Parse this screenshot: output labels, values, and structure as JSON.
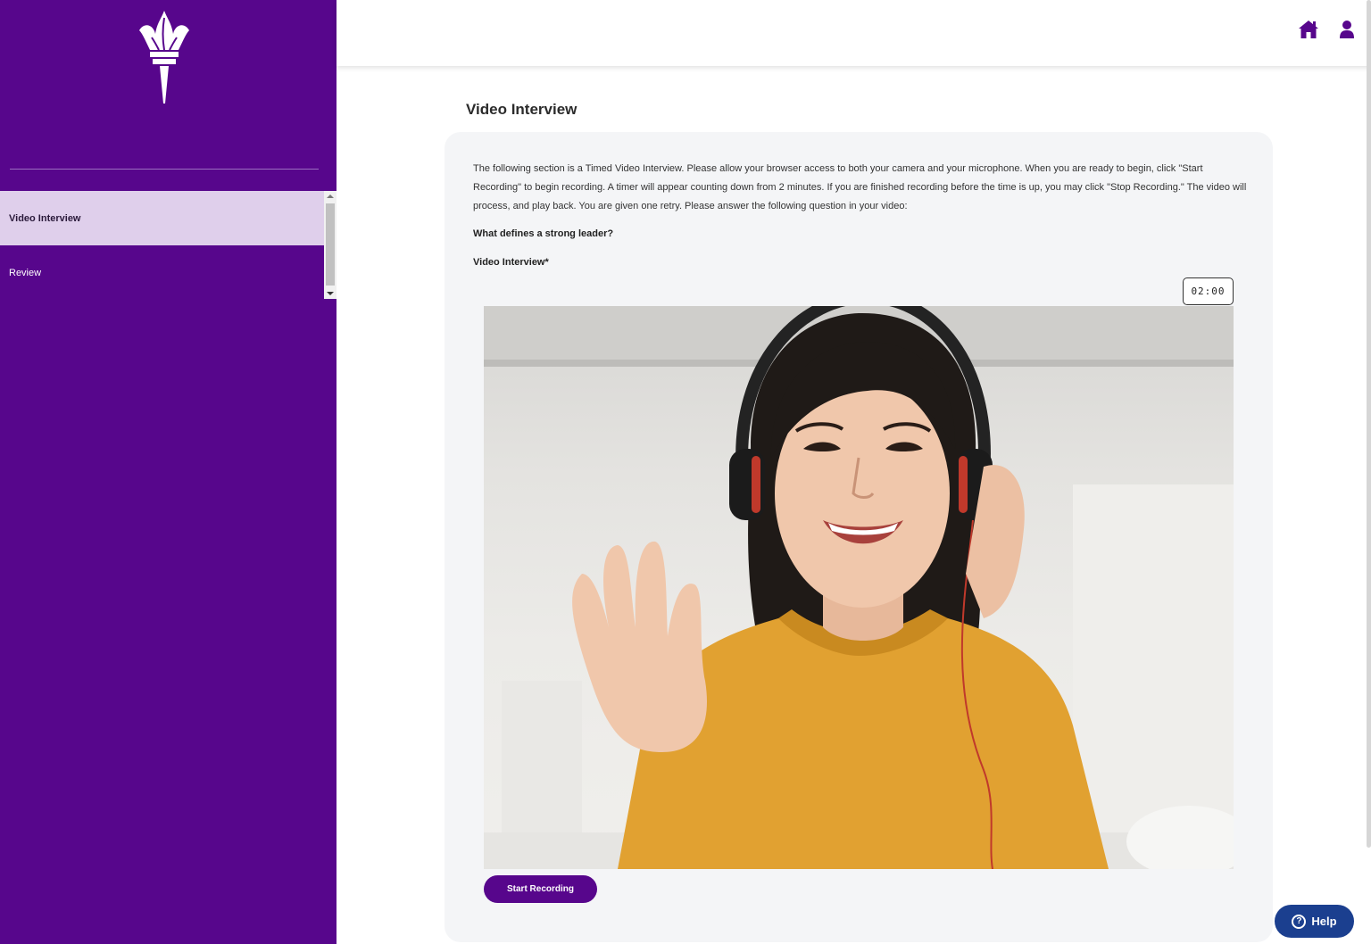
{
  "sidebar": {
    "items": [
      {
        "label": "Video Interview",
        "active": true
      },
      {
        "label": "Review",
        "active": false
      }
    ]
  },
  "header": {
    "icons": [
      "home-icon",
      "user-icon"
    ]
  },
  "main": {
    "title": "Video Interview",
    "instructions": "The following section is a Timed Video Interview. Please allow your browser access to both your camera and your microphone. When you are ready to begin, click \"Start Recording\" to begin recording. A timer will appear counting down from 2 minutes. If you are finished recording before the time is up, you may click \"Stop Recording.\" The video will process, and play back. You are given one retry. Please answer the following question in your video:",
    "question": "What defines a strong leader?",
    "field_label": "Video Interview*",
    "timer": "02:00",
    "start_button": "Start Recording"
  },
  "help": {
    "label": "Help",
    "icon": "?"
  },
  "colors": {
    "brand_purple": "#57068c",
    "active_nav_bg": "#dfcfeb",
    "help_blue": "#1b3f8f",
    "card_bg": "#f4f5f7"
  }
}
